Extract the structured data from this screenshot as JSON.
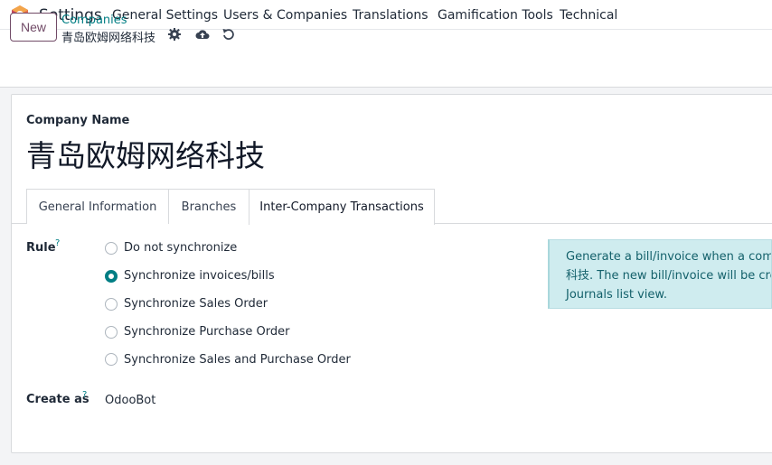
{
  "navbar": {
    "app_name": "Settings",
    "menu": [
      "General Settings",
      "Users & Companies",
      "Translations",
      "Gamification Tools",
      "Technical"
    ]
  },
  "control": {
    "new_label": "New",
    "breadcrumb": "Companies",
    "record_name": "青岛欧姆网络科技"
  },
  "form": {
    "company_name_label": "Company Name",
    "company_name": "青岛欧姆网络科技",
    "tabs": [
      "General Information",
      "Branches",
      "Inter-Company Transactions"
    ],
    "active_tab": "Inter-Company Transactions",
    "rule_label": "Rule",
    "help_mark": "?",
    "rule_options": [
      {
        "label": "Do not synchronize",
        "checked": false
      },
      {
        "label": "Synchronize invoices/bills",
        "checked": true
      },
      {
        "label": "Synchronize Sales Order",
        "checked": false
      },
      {
        "label": "Synchronize Purchase Order",
        "checked": false
      },
      {
        "label": "Synchronize Sales and Purchase Order",
        "checked": false
      }
    ],
    "create_as_label": "Create as",
    "create_as_value": "OdooBot",
    "info_lines": [
      "Generate a bill/invoice when a compa",
      "科技. The new bill/invoice will be crea",
      "Journals list view."
    ]
  },
  "colors": {
    "brand": "#714b67",
    "accent": "#017e84",
    "info_bg": "#cfecef"
  }
}
